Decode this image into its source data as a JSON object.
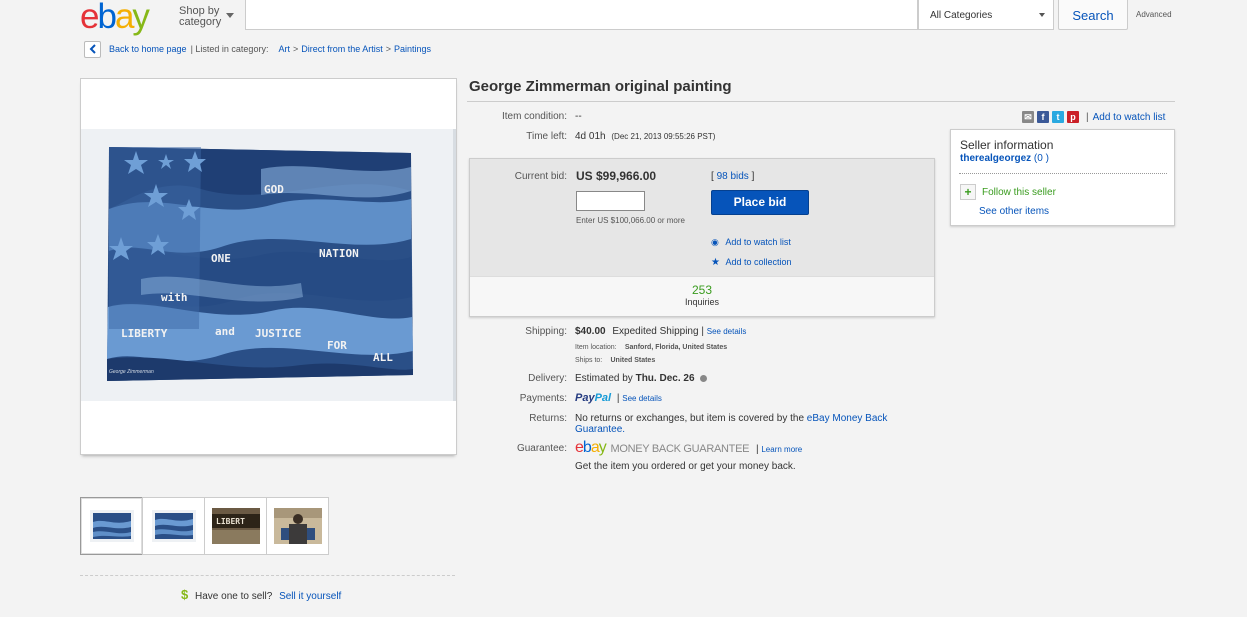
{
  "header": {
    "logo_letters": [
      "e",
      "b",
      "a",
      "y"
    ],
    "shop_by_line1": "Shop by",
    "shop_by_line2": "category",
    "search_placeholder": "",
    "category_selected": "All Categories",
    "search_button": "Search",
    "advanced": "Advanced"
  },
  "breadcrumb": {
    "back": "Back to home page",
    "listed_in": "| Listed in category:",
    "crumbs": [
      "Art",
      "Direct from the Artist",
      "Paintings"
    ]
  },
  "painting": {
    "words": [
      "GOD",
      "ONE",
      "NATION",
      "with",
      "LIBERTY",
      "and",
      "JUSTICE",
      "FOR",
      "ALL"
    ],
    "signature": "George Zimmerman"
  },
  "thumb_labels": [
    "LIBERT"
  ],
  "item": {
    "title": "George Zimmerman original painting",
    "condition_label": "Item condition:",
    "condition_value": "--",
    "time_left_label": "Time left:",
    "time_left_value": "4d 01h",
    "time_left_detail": "(Dec 21, 2013  09:55:26 PST)"
  },
  "share": {
    "add_to_watch": "Add to watch list",
    "separator": "|"
  },
  "bid": {
    "current_bid_label": "Current bid:",
    "current_bid_value": "US $99,966.00",
    "bids_link": "98 bids",
    "input_value": "",
    "enter_hint": "Enter US $100,066.00 or more",
    "place_bid": "Place bid",
    "add_to_watch": "Add to watch list",
    "add_to_collection": "Add to collection",
    "inquiries_count": "253",
    "inquiries_label": "Inquiries"
  },
  "shipping": {
    "label": "Shipping:",
    "cost": "$40.00",
    "method": "Expedited Shipping",
    "separator": "|",
    "see_details": "See details",
    "item_location_label": "Item location:",
    "item_location_value": "Sanford, Florida, United States",
    "ships_to_label": "Ships to:",
    "ships_to_value": "United States"
  },
  "delivery": {
    "label": "Delivery:",
    "prefix": "Estimated by",
    "date": "Thu. Dec. 26"
  },
  "payments": {
    "label": "Payments:",
    "paypal_pay": "Pay",
    "paypal_pal": "Pal",
    "separator": "|",
    "see_details": "See details"
  },
  "returns": {
    "label": "Returns:",
    "text": "No returns or exchanges, but item is covered by the",
    "link_part1": "eBay Money Back",
    "link_part2": "Guarantee."
  },
  "guarantee": {
    "label": "Guarantee:",
    "badge_text": "MONEY BACK GUARANTEE",
    "separator": "|",
    "learn_more": "Learn more",
    "description": "Get the item you ordered or get your money back."
  },
  "seller": {
    "title": "Seller information",
    "name": "therealgeorgez",
    "count": "(0 )",
    "follow": "Follow this seller",
    "see_other": "See other items"
  },
  "sell": {
    "symbol": "$",
    "prompt": "Have one to sell?",
    "link": "Sell it yourself"
  },
  "colors": {
    "ebay_red": "#e53238",
    "ebay_blue": "#0064d2",
    "ebay_yellow": "#f5af02",
    "ebay_green": "#86b817",
    "link_blue": "#0654ba",
    "place_bid_blue": "#0654ba",
    "inquiries_green": "#3a9c1f"
  }
}
